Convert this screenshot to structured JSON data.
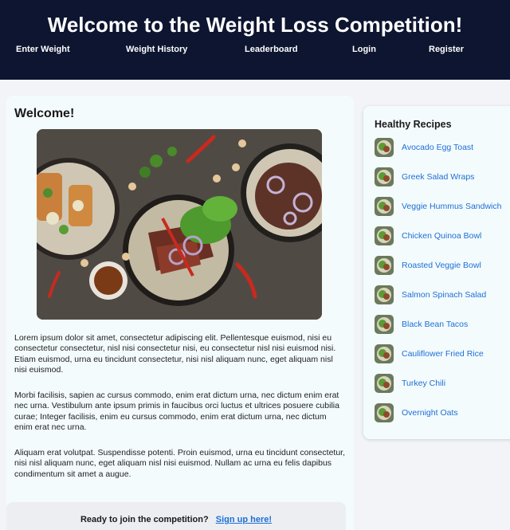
{
  "header": {
    "title": "Welcome to the Weight Loss Competition!",
    "nav": [
      "Enter Weight",
      "Weight History",
      "Leaderboard",
      "Login",
      "Register"
    ]
  },
  "main": {
    "heading": "Welcome!",
    "hero_image": "healthy-food-bowls-photo",
    "paragraphs": [
      "Lorem ipsum dolor sit amet, consectetur adipiscing elit. Pellentesque euismod, nisi eu consectetur consectetur, nisl nisi consectetur nisi, eu consectetur nisl nisi euismod nisi. Etiam euismod, urna eu tincidunt consectetur, nisi nisl aliquam nunc, eget aliquam nisl nisi euismod.",
      "Morbi facilisis, sapien ac cursus commodo, enim erat dictum urna, nec dictum enim erat nec urna. Vestibulum ante ipsum primis in faucibus orci luctus et ultrices posuere cubilia curae; Integer facilisis, enim eu cursus commodo, enim erat dictum urna, nec dictum enim erat nec urna.",
      "Aliquam erat volutpat. Suspendisse potenti. Proin euismod, urna eu tincidunt consectetur, nisi nisl aliquam nunc, eget aliquam nisl nisi euismod. Nullam ac urna eu felis dapibus condimentum sit amet a augue."
    ],
    "cta": {
      "text": "Ready to join the competition?",
      "link": "Sign up here!"
    }
  },
  "sidebar": {
    "title": "Healthy Recipes",
    "recipes": [
      "Avocado Egg Toast",
      "Greek Salad Wraps",
      "Veggie Hummus Sandwich",
      "Chicken Quinoa Bowl",
      "Roasted Veggie Bowl",
      "Salmon Spinach Salad",
      "Black Bean Tacos",
      "Cauliflower Fried Rice",
      "Turkey Chili",
      "Overnight Oats"
    ]
  },
  "colors": {
    "header_bg": "#0d1530",
    "link": "#1d6fd6",
    "panel_bg": "#f4fbfd",
    "page_bg": "#f2f4f7"
  }
}
